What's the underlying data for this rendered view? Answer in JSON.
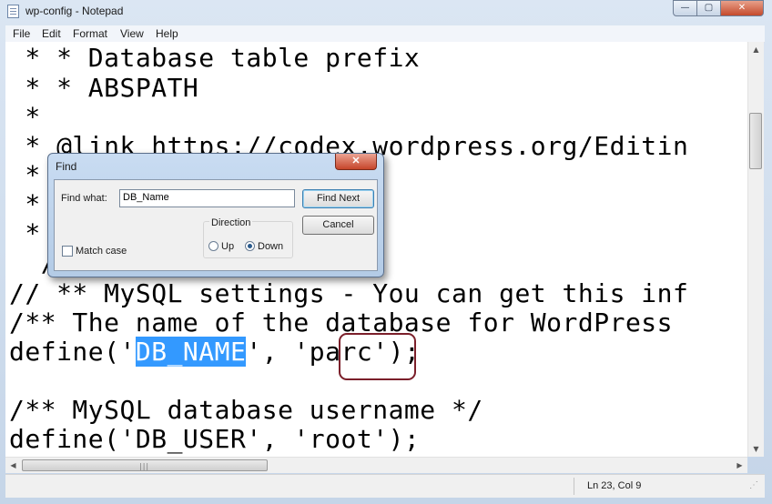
{
  "window": {
    "title": "wp-config - Notepad",
    "controls": {
      "minimize": "—",
      "maximize": "▢",
      "close": "✕"
    }
  },
  "menu": [
    "File",
    "Edit",
    "Format",
    "View",
    "Help"
  ],
  "editor": {
    "lines": [
      " * * Database table prefix",
      " * * ABSPATH",
      " *",
      " * @link https://codex.wordpress.org/Editin",
      " *",
      " *",
      " *",
      "  /",
      "",
      "// ** MySQL settings - You can get this inf",
      "/** The name of the database for WordPress",
      "define('DB_NAME', 'parc');",
      "",
      "/** MySQL database username */",
      "define('DB_USER', 'root');"
    ],
    "selected_line": {
      "before": "define('",
      "selected": "DB_NAME",
      "after": "', 'parc');"
    }
  },
  "statusbar": {
    "position": "Ln 23, Col 9"
  },
  "find_dialog": {
    "title": "Find",
    "close": "✕",
    "find_what_label": "Find what:",
    "find_what_value": "DB_Name",
    "find_next": "Find Next",
    "cancel": "Cancel",
    "direction_label": "Direction",
    "up_label": "Up",
    "down_label": "Down",
    "selected_direction": "Down",
    "match_case_label": "Match case",
    "match_case_checked": false
  },
  "colors": {
    "selection": "#3399ff",
    "highlight_box": "#7b1f2a",
    "close_button": "#c44a2b"
  }
}
